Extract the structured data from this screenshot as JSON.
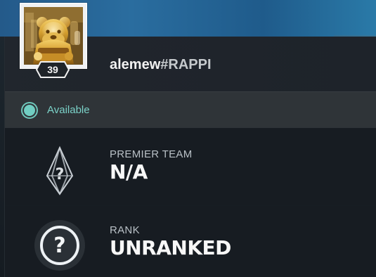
{
  "profile": {
    "username": "alemew",
    "tag": "#RAPPI",
    "level": "39",
    "avatar_icon": "golden-bear-astronaut-icon"
  },
  "status": {
    "label": "Available",
    "color": "#71cec2",
    "icon": "status-dot-icon"
  },
  "premier": {
    "title": "PREMIER TEAM",
    "value": "N/A",
    "icon": "premier-team-icon",
    "glyph": "?"
  },
  "rank": {
    "title": "RANK",
    "value": "UNRANKED",
    "icon": "rank-icon",
    "glyph": "?"
  },
  "colors": {
    "background_accent": "#2a6d9f",
    "panel": "#191f26",
    "status_row": "#2f3438",
    "text_primary": "#f7f7f7",
    "text_secondary": "#b9c0c6",
    "gold": "#d3a43e"
  }
}
